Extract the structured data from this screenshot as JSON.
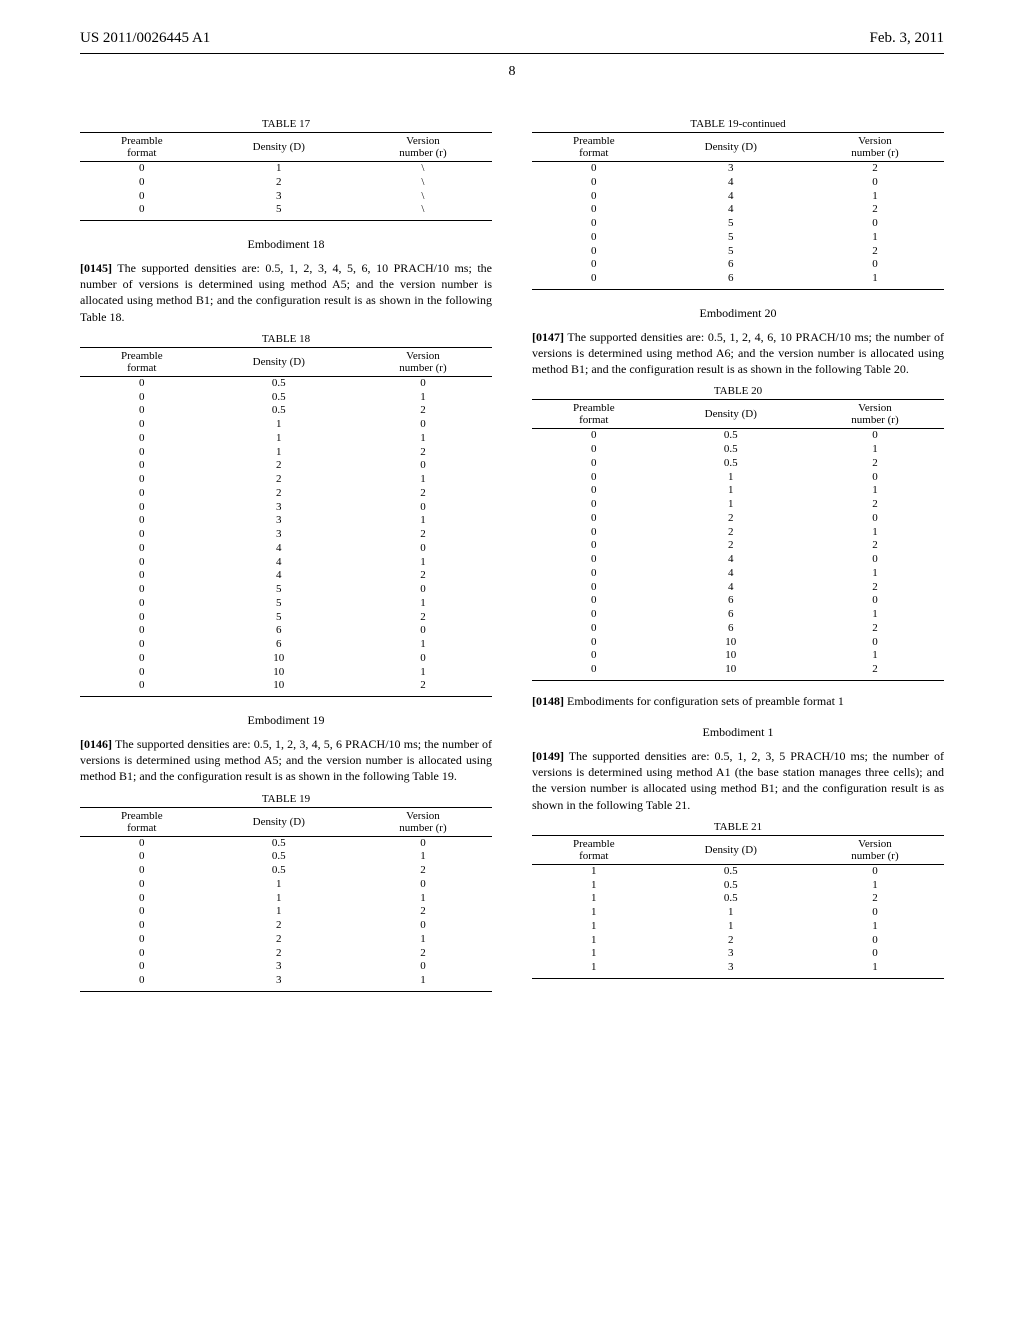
{
  "header": {
    "pubno": "US 2011/0026445 A1",
    "date": "Feb. 3, 2011"
  },
  "pagenum": "8",
  "t17": {
    "caption": "TABLE 17",
    "cols": [
      "Preamble\nformat",
      "Density (D)",
      "Version\nnumber (r)"
    ],
    "rows": [
      [
        "0",
        "1",
        "\\"
      ],
      [
        "0",
        "2",
        "\\"
      ],
      [
        "0",
        "3",
        "\\"
      ],
      [
        "0",
        "5",
        "\\"
      ]
    ]
  },
  "emb18": {
    "title": "Embodiment 18",
    "paranum": "[0145]",
    "text": "   The supported densities are: 0.5, 1, 2, 3, 4, 5, 6, 10 PRACH/10 ms; the number of versions is determined using method A5; and the version number is allocated using method B1; and the configuration result is as shown in the following Table 18."
  },
  "t18": {
    "caption": "TABLE 18",
    "cols": [
      "Preamble\nformat",
      "Density (D)",
      "Version\nnumber (r)"
    ],
    "rows": [
      [
        "0",
        "0.5",
        "0"
      ],
      [
        "0",
        "0.5",
        "1"
      ],
      [
        "0",
        "0.5",
        "2"
      ],
      [
        "0",
        "1",
        "0"
      ],
      [
        "0",
        "1",
        "1"
      ],
      [
        "0",
        "1",
        "2"
      ],
      [
        "0",
        "2",
        "0"
      ],
      [
        "0",
        "2",
        "1"
      ],
      [
        "0",
        "2",
        "2"
      ],
      [
        "0",
        "3",
        "0"
      ],
      [
        "0",
        "3",
        "1"
      ],
      [
        "0",
        "3",
        "2"
      ],
      [
        "0",
        "4",
        "0"
      ],
      [
        "0",
        "4",
        "1"
      ],
      [
        "0",
        "4",
        "2"
      ],
      [
        "0",
        "5",
        "0"
      ],
      [
        "0",
        "5",
        "1"
      ],
      [
        "0",
        "5",
        "2"
      ],
      [
        "0",
        "6",
        "0"
      ],
      [
        "0",
        "6",
        "1"
      ],
      [
        "0",
        "10",
        "0"
      ],
      [
        "0",
        "10",
        "1"
      ],
      [
        "0",
        "10",
        "2"
      ]
    ]
  },
  "emb19": {
    "title": "Embodiment 19",
    "paranum": "[0146]",
    "text": "   The supported densities are: 0.5, 1, 2, 3, 4, 5, 6 PRACH/10 ms; the number of versions is determined using method A5; and the version number is allocated using method B1; and the configuration result is as shown in the following Table 19."
  },
  "t19": {
    "caption": "TABLE 19",
    "cols": [
      "Preamble\nformat",
      "Density (D)",
      "Version\nnumber (r)"
    ],
    "rows": [
      [
        "0",
        "0.5",
        "0"
      ],
      [
        "0",
        "0.5",
        "1"
      ],
      [
        "0",
        "0.5",
        "2"
      ],
      [
        "0",
        "1",
        "0"
      ],
      [
        "0",
        "1",
        "1"
      ],
      [
        "0",
        "1",
        "2"
      ],
      [
        "0",
        "2",
        "0"
      ],
      [
        "0",
        "2",
        "1"
      ],
      [
        "0",
        "2",
        "2"
      ],
      [
        "0",
        "3",
        "0"
      ],
      [
        "0",
        "3",
        "1"
      ]
    ]
  },
  "t19c": {
    "caption": "TABLE 19-continued",
    "cols": [
      "Preamble\nformat",
      "Density (D)",
      "Version\nnumber (r)"
    ],
    "rows": [
      [
        "0",
        "3",
        "2"
      ],
      [
        "0",
        "4",
        "0"
      ],
      [
        "0",
        "4",
        "1"
      ],
      [
        "0",
        "4",
        "2"
      ],
      [
        "0",
        "5",
        "0"
      ],
      [
        "0",
        "5",
        "1"
      ],
      [
        "0",
        "5",
        "2"
      ],
      [
        "0",
        "6",
        "0"
      ],
      [
        "0",
        "6",
        "1"
      ]
    ]
  },
  "emb20": {
    "title": "Embodiment 20",
    "paranum": "[0147]",
    "text": "   The supported densities are: 0.5, 1, 2, 4, 6, 10 PRACH/10 ms; the number of versions is determined using method A6; and the version number is allocated using method B1; and the configuration result is as shown in the following Table 20."
  },
  "t20": {
    "caption": "TABLE 20",
    "cols": [
      "Preamble\nformat",
      "Density (D)",
      "Version\nnumber (r)"
    ],
    "rows": [
      [
        "0",
        "0.5",
        "0"
      ],
      [
        "0",
        "0.5",
        "1"
      ],
      [
        "0",
        "0.5",
        "2"
      ],
      [
        "0",
        "1",
        "0"
      ],
      [
        "0",
        "1",
        "1"
      ],
      [
        "0",
        "1",
        "2"
      ],
      [
        "0",
        "2",
        "0"
      ],
      [
        "0",
        "2",
        "1"
      ],
      [
        "0",
        "2",
        "2"
      ],
      [
        "0",
        "4",
        "0"
      ],
      [
        "0",
        "4",
        "1"
      ],
      [
        "0",
        "4",
        "2"
      ],
      [
        "0",
        "6",
        "0"
      ],
      [
        "0",
        "6",
        "1"
      ],
      [
        "0",
        "6",
        "2"
      ],
      [
        "0",
        "10",
        "0"
      ],
      [
        "0",
        "10",
        "1"
      ],
      [
        "0",
        "10",
        "2"
      ]
    ]
  },
  "pre_f1": {
    "paranum": "[0148]",
    "text": "   Embodiments for configuration sets of preamble format 1"
  },
  "emb1_f1": {
    "title": "Embodiment 1",
    "paranum": "[0149]",
    "text": "   The supported densities are: 0.5, 1, 2, 3, 5 PRACH/10 ms; the number of versions is determined using method A1 (the base station manages three cells); and the version number is allocated using method B1; and the configuration result is as shown in the following Table 21."
  },
  "t21": {
    "caption": "TABLE 21",
    "cols": [
      "Preamble\nformat",
      "Density (D)",
      "Version\nnumber (r)"
    ],
    "rows": [
      [
        "1",
        "0.5",
        "0"
      ],
      [
        "1",
        "0.5",
        "1"
      ],
      [
        "1",
        "0.5",
        "2"
      ],
      [
        "1",
        "1",
        "0"
      ],
      [
        "1",
        "1",
        "1"
      ],
      [
        "1",
        "2",
        "0"
      ],
      [
        "1",
        "3",
        "0"
      ],
      [
        "1",
        "3",
        "1"
      ]
    ]
  }
}
